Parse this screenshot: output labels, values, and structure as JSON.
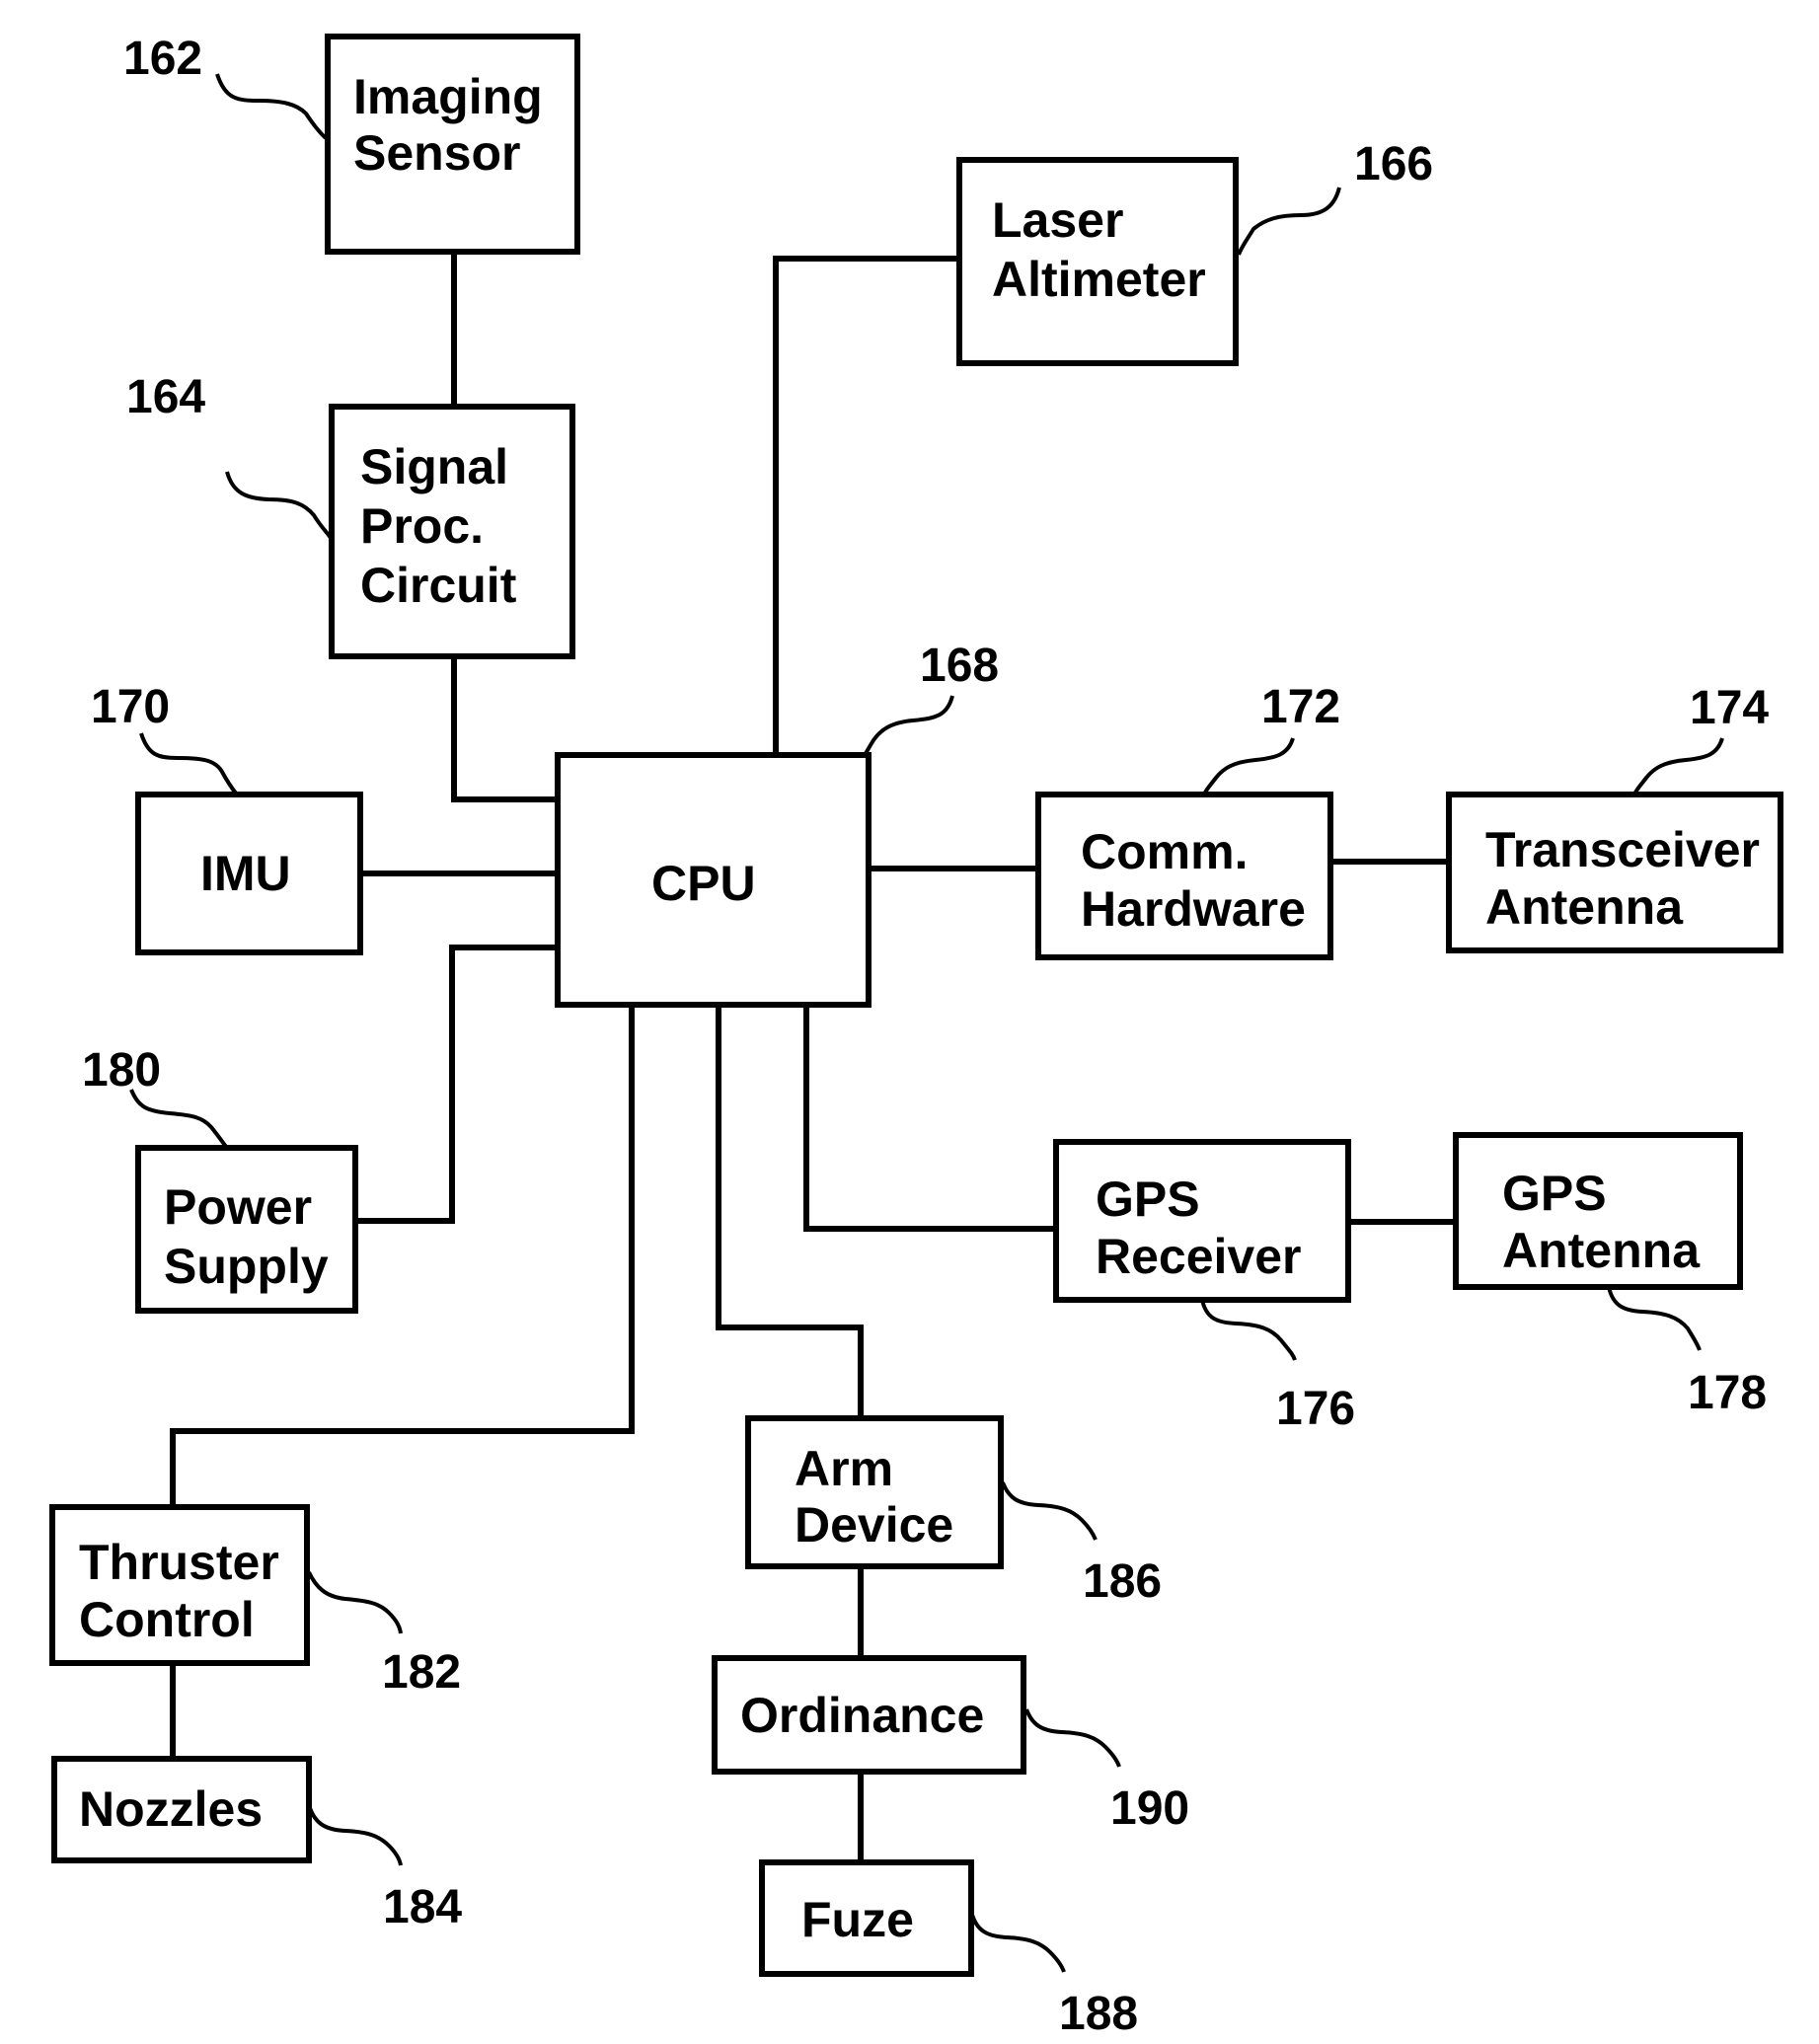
{
  "figure": {
    "blocks": {
      "imaging_sensor": {
        "lines": [
          "Imaging",
          "Sensor"
        ],
        "ref": "162"
      },
      "signal_proc": {
        "lines": [
          "Signal",
          "Proc.",
          "Circuit"
        ],
        "ref": "164"
      },
      "laser_altimeter": {
        "lines": [
          "Laser",
          "Altimeter"
        ],
        "ref": "166"
      },
      "cpu": {
        "lines": [
          "CPU"
        ],
        "ref": "168"
      },
      "imu": {
        "lines": [
          "IMU"
        ],
        "ref": "170"
      },
      "comm_hardware": {
        "lines": [
          "Comm.",
          "Hardware"
        ],
        "ref": "172"
      },
      "transceiver_antenna": {
        "lines": [
          "Transceiver",
          "Antenna"
        ],
        "ref": "174"
      },
      "gps_receiver": {
        "lines": [
          "GPS",
          "Receiver"
        ],
        "ref": "176"
      },
      "gps_antenna": {
        "lines": [
          "GPS",
          "Antenna"
        ],
        "ref": "178"
      },
      "power_supply": {
        "lines": [
          "Power",
          "Supply"
        ],
        "ref": "180"
      },
      "thruster_control": {
        "lines": [
          "Thruster",
          "Control"
        ],
        "ref": "182"
      },
      "nozzles": {
        "lines": [
          "Nozzles"
        ],
        "ref": "184"
      },
      "arm_device": {
        "lines": [
          "Arm",
          "Device"
        ],
        "ref": "186"
      },
      "fuze": {
        "lines": [
          "Fuze"
        ],
        "ref": "188"
      },
      "ordinance": {
        "lines": [
          "Ordinance"
        ],
        "ref": "190"
      }
    },
    "connections": [
      [
        "imaging_sensor",
        "signal_proc"
      ],
      [
        "signal_proc",
        "cpu"
      ],
      [
        "laser_altimeter",
        "cpu"
      ],
      [
        "imu",
        "cpu"
      ],
      [
        "power_supply",
        "cpu"
      ],
      [
        "cpu",
        "comm_hardware"
      ],
      [
        "comm_hardware",
        "transceiver_antenna"
      ],
      [
        "cpu",
        "gps_receiver"
      ],
      [
        "gps_receiver",
        "gps_antenna"
      ],
      [
        "cpu",
        "thruster_control"
      ],
      [
        "thruster_control",
        "nozzles"
      ],
      [
        "cpu",
        "arm_device"
      ],
      [
        "arm_device",
        "ordinance"
      ],
      [
        "ordinance",
        "fuze"
      ]
    ]
  }
}
